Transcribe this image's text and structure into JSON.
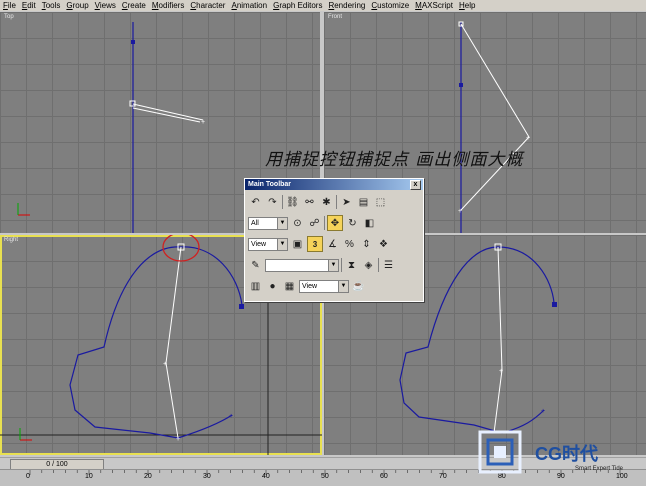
{
  "menu": [
    "File",
    "Edit",
    "Tools",
    "Group",
    "Views",
    "Create",
    "Modifiers",
    "Character",
    "Animation",
    "Graph Editors",
    "Rendering",
    "Customize",
    "MAXScript",
    "Help"
  ],
  "viewports": {
    "top_label": "Top",
    "front_label": "Front",
    "right_label": "Right",
    "perspective_label": ""
  },
  "overlay_text": "用捕捉控钮捕捉点  画出侧面大概",
  "toolbar": {
    "title": "Main Toolbar",
    "close": "x",
    "selection_filter": "All",
    "ref_coord_1": "View",
    "named_selection": "",
    "ref_coord_2": "View",
    "snap_label": "3",
    "angle_snap_label": "%"
  },
  "timeline": {
    "frame_display": "0 / 100",
    "ticks": [
      "0",
      "10",
      "20",
      "30",
      "40",
      "50",
      "60",
      "70",
      "80",
      "90",
      "100"
    ]
  },
  "logo": {
    "brand": "CG时代",
    "status": "Smart Expert Tide"
  },
  "colors": {
    "viewport_bg": "#7f7f7f",
    "spline_blue": "#2020a0",
    "active_border": "#e8e050",
    "highlight_circle": "#d02020"
  }
}
